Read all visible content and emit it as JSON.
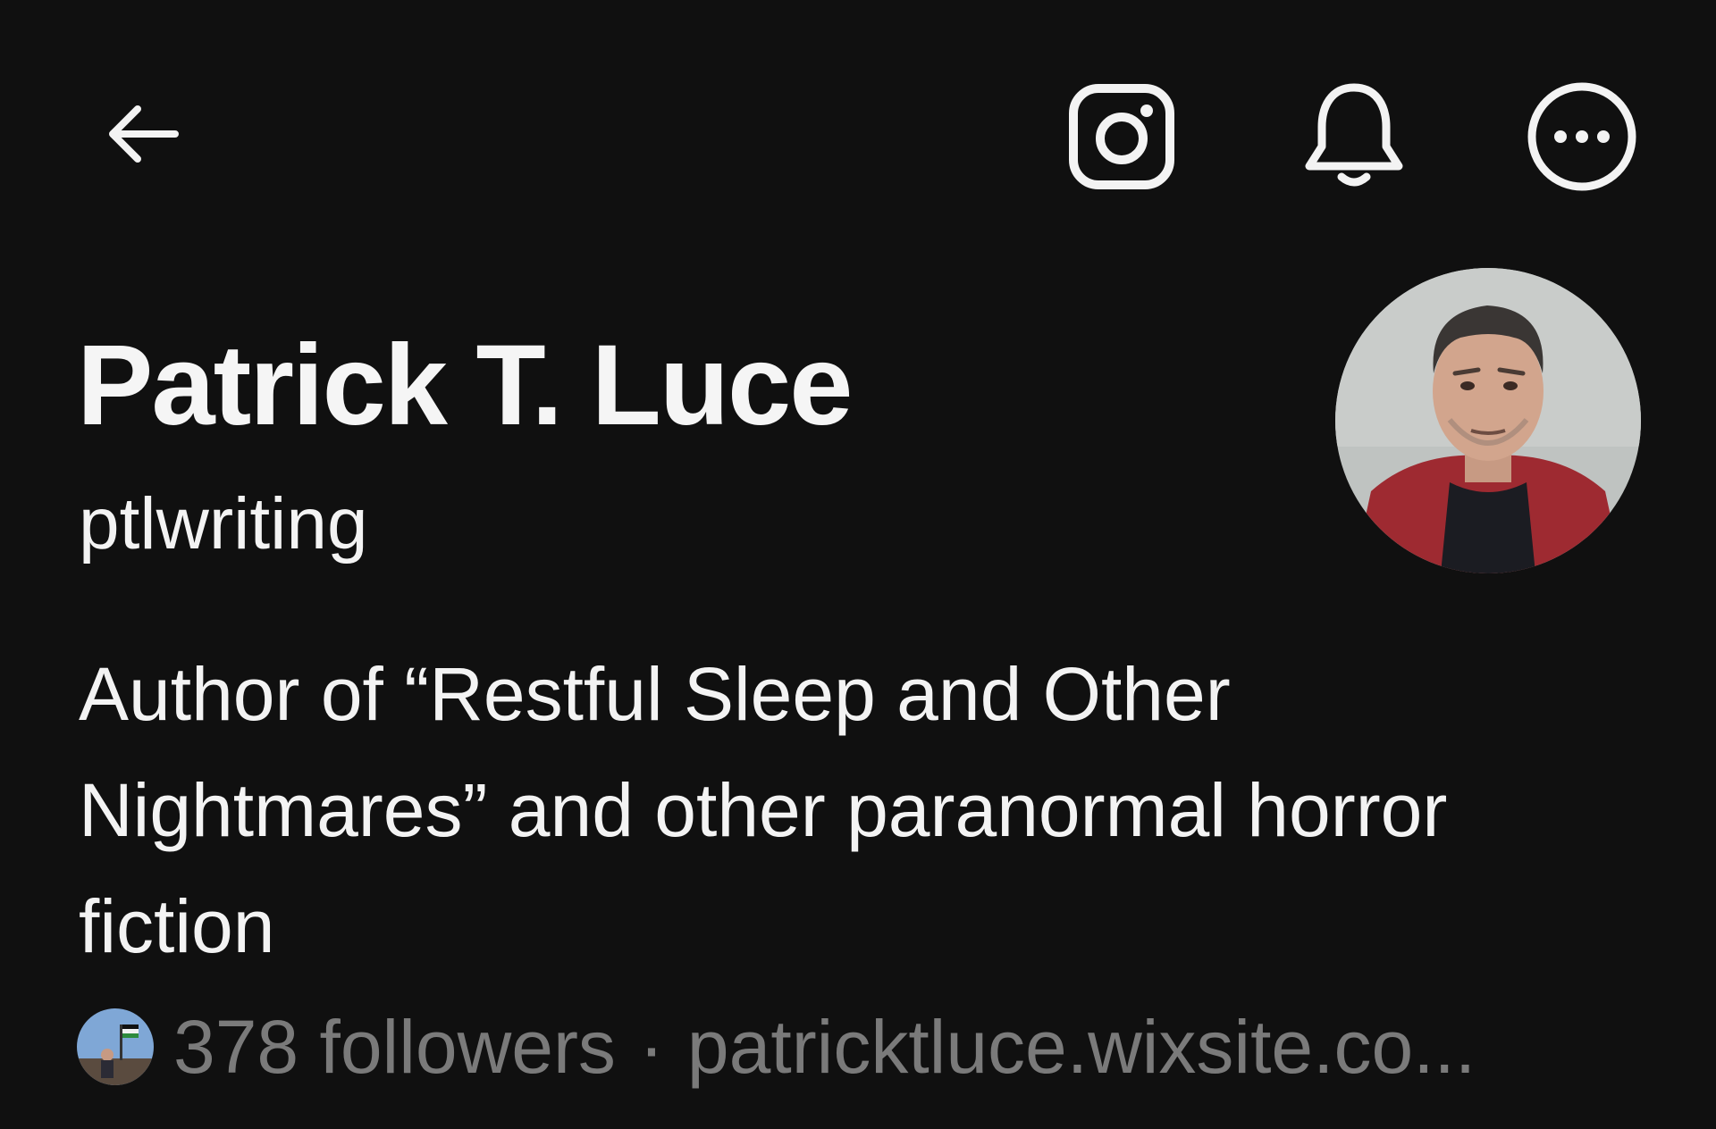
{
  "profile": {
    "display_name": "Patrick T. Luce",
    "handle": "ptlwriting",
    "bio": "Author of “Restful Sleep and Other Nightmares” and other paranormal horror fiction",
    "followers_text": "378 followers",
    "separator": "·",
    "link_text": "patricktluce.wixsite.co..."
  },
  "icons": {
    "back": "arrow-left-icon",
    "instagram": "instagram-icon",
    "notifications": "bell-icon",
    "more": "more-horizontal-icon"
  },
  "colors": {
    "background": "#101010",
    "primary_text": "#f3f3f3",
    "secondary_text": "#7a7a7a"
  }
}
